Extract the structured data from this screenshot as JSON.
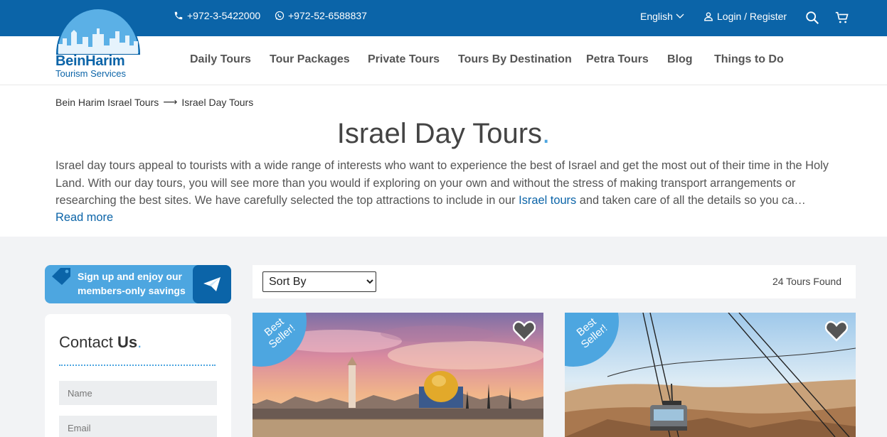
{
  "header": {
    "phone1": "+972-3-5422000",
    "phone2": "+972-52-6588837",
    "language": "English",
    "login": "Login / Register"
  },
  "logo": {
    "brand": "BeinHarim",
    "subtitle": "Tourism Services"
  },
  "nav": {
    "items": [
      "Daily Tours",
      "Tour Packages",
      "Private Tours",
      "Tours By Destination",
      "Petra Tours",
      "Blog",
      "Things to Do"
    ]
  },
  "breadcrumb": {
    "home": "Bein Harim Israel Tours",
    "separator": "⟶",
    "current": "Israel Day Tours"
  },
  "page": {
    "title": "Israel Day Tours",
    "title_dot": ".",
    "intro_before_link": "Israel day tours appeal to tourists with a wide range of interests who want to experience the best of Israel and get the most out of their time in the Holy Land. With our day tours, you will see more than you would if exploring on your own and without the stress of making transport arrangements or researching the best sites. We have carefully selected the top attractions to include in our ",
    "intro_link": "Israel tours",
    "intro_after_link": " and taken care of all the details so you ca…",
    "read_more": "Read more"
  },
  "signup": {
    "line1": "Sign up and enjoy our",
    "line2": "members-only savings"
  },
  "contact": {
    "title_regular": "Contact ",
    "title_bold": "Us",
    "title_dot": ".",
    "name_placeholder": "Name",
    "email_placeholder": "Email"
  },
  "listing": {
    "sort_selected": "Sort By",
    "count": "24 Tours Found"
  },
  "cards": [
    {
      "badge": "Best Seller!",
      "image": "jerusalem-dome-of-the-rock-photo"
    },
    {
      "badge": "Best Seller!",
      "image": "masada-cable-car-photo"
    }
  ],
  "colors": {
    "brand_blue": "#0b64a8",
    "accent_blue": "#4da6e0",
    "background_gray": "#f2f3f5"
  }
}
